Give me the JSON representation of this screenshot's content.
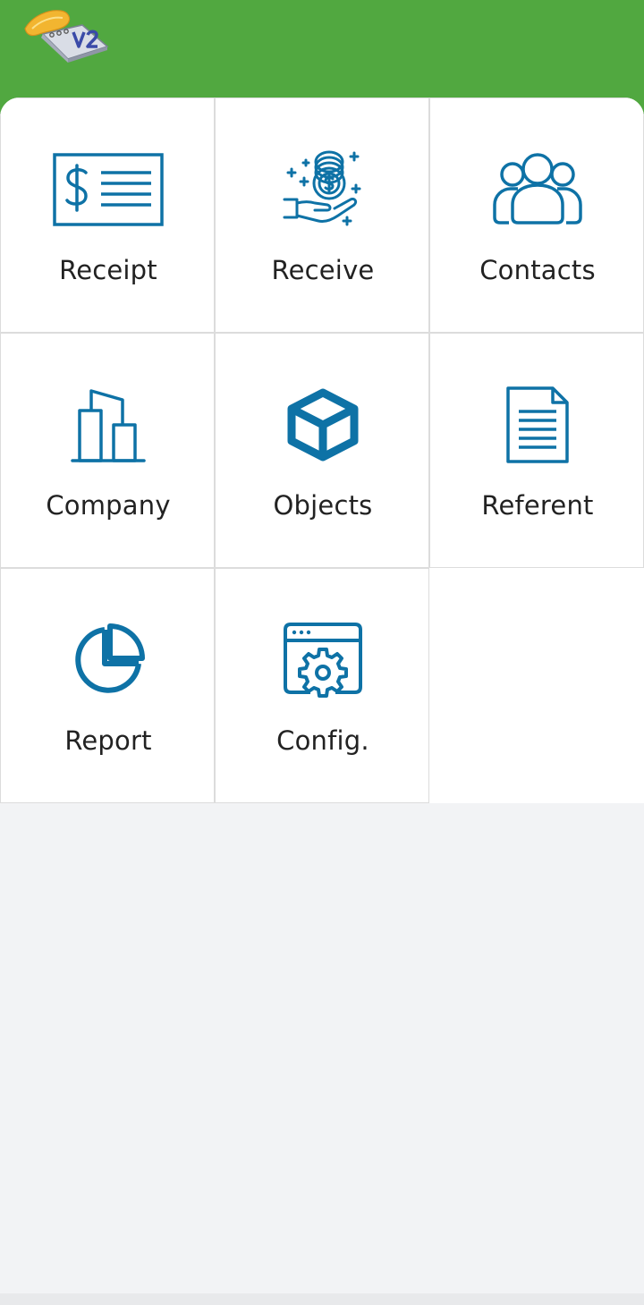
{
  "colors": {
    "header_green": "#51a840",
    "icon_blue": "#0e72a6",
    "background": "#f2f3f5"
  },
  "header": {
    "logo_icon": "app-logo-v2"
  },
  "menu": {
    "items": [
      {
        "label": "Receipt",
        "icon": "receipt-dollar-icon"
      },
      {
        "label": "Receive",
        "icon": "hand-coins-icon"
      },
      {
        "label": "Contacts",
        "icon": "people-group-icon"
      },
      {
        "label": "Company",
        "icon": "buildings-icon"
      },
      {
        "label": "Objects",
        "icon": "cube-icon"
      },
      {
        "label": "Referent",
        "icon": "document-icon"
      },
      {
        "label": "Report",
        "icon": "pie-chart-icon"
      },
      {
        "label": "Config.",
        "icon": "browser-gear-icon"
      }
    ]
  }
}
